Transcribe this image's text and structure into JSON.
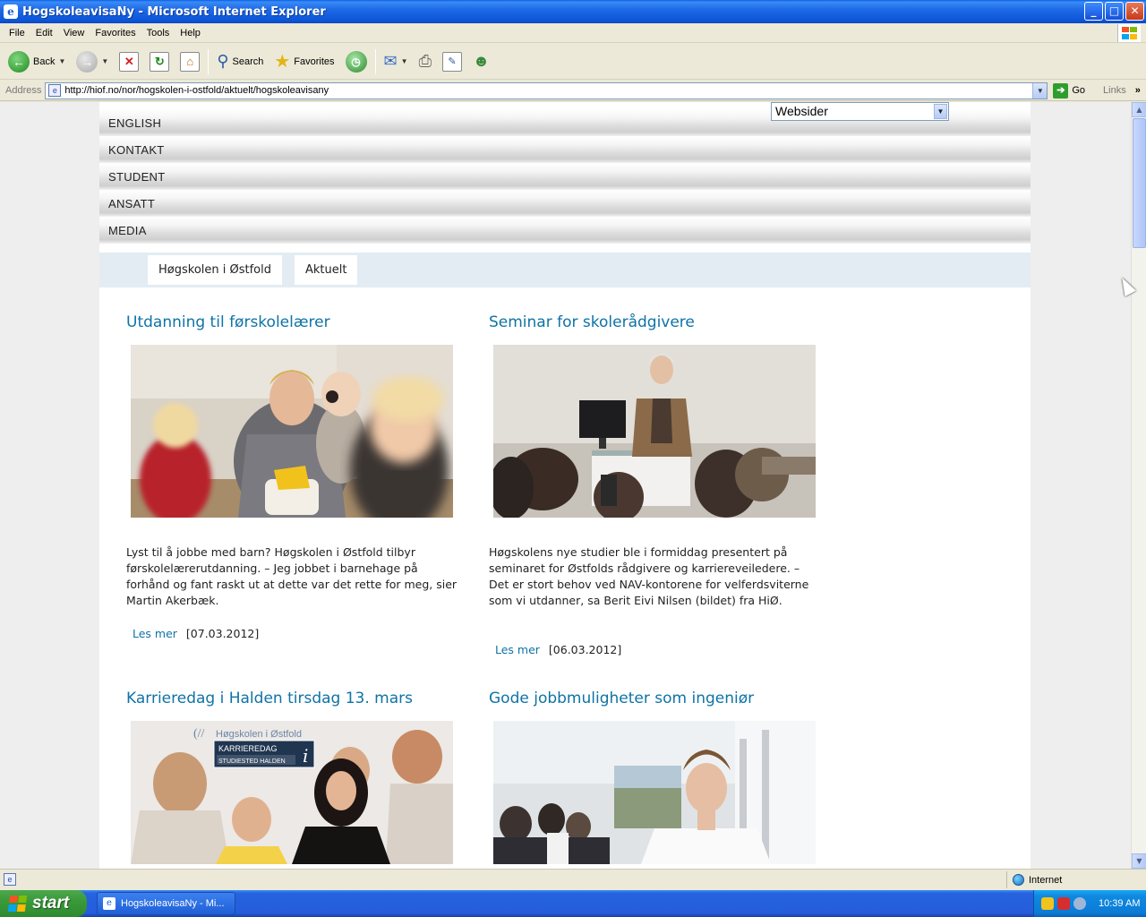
{
  "window": {
    "title": "HogskoleavisaNy - Microsoft Internet Explorer",
    "buttons": {
      "minimize": "_",
      "maximize": "□",
      "close": "✕"
    }
  },
  "menu": [
    "File",
    "Edit",
    "View",
    "Favorites",
    "Tools",
    "Help"
  ],
  "toolbar": {
    "back_label": "Back",
    "search_label": "Search",
    "favorites_label": "Favorites"
  },
  "address": {
    "label": "Address",
    "url": "http://hiof.no/nor/hogskolen-i-ostfold/aktuelt/hogskoleavisany",
    "go_label": "Go",
    "links_label": "Links"
  },
  "site": {
    "nav": [
      "ENGLISH",
      "KONTAKT",
      "STUDENT",
      "ANSATT",
      "MEDIA"
    ],
    "search_select": "Websider",
    "breadcrumb": [
      "Høgskolen i Østfold",
      "Aktuelt"
    ]
  },
  "articles": [
    {
      "title": "Utdanning til førskolelærer",
      "excerpt": "Lyst til å jobbe med barn? Høgskolen i Østfold tilbyr førskolelærerutdanning. – Jeg jobbet i barnehage på forhånd og fant raskt ut at dette var det rette for meg, sier Martin Akerbæk.",
      "read_more": "Les mer",
      "date": "[07.03.2012]"
    },
    {
      "title": "Seminar for skolerådgivere",
      "excerpt": "Høgskolens nye studier ble i formiddag presentert på seminaret for Østfolds rådgivere og karriereveiledere. – Det er stort behov ved NAV-kontorene for velferdsviterne som vi utdanner, sa Berit Eivi Nilsen (bildet) fra HiØ.",
      "read_more": "Les mer",
      "date": "[06.03.2012]"
    },
    {
      "title": "Karrieredag i Halden tirsdag 13. mars",
      "photo_text": {
        "org": "Høgskolen i Østfold",
        "badge_title": "KARRIEREDAG",
        "badge_subtitle": "STUDIESTED HALDEN"
      }
    },
    {
      "title": "Gode jobbmuligheter som ingeniør"
    }
  ],
  "status": {
    "zone": "Internet"
  },
  "taskbar": {
    "start_label": "start",
    "task_label": "HogskoleavisaNy - Mi...",
    "clock": "10:39 AM"
  }
}
